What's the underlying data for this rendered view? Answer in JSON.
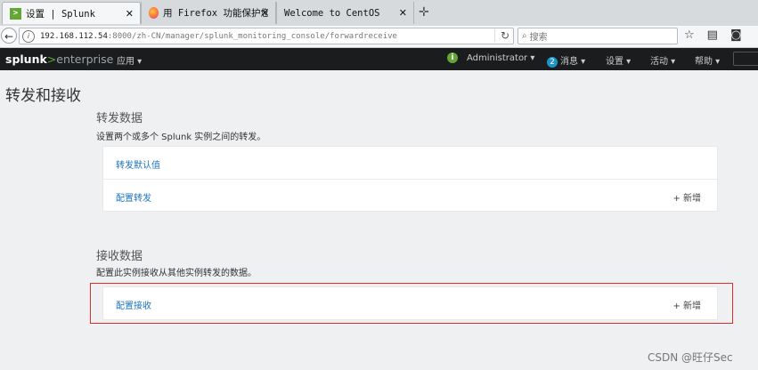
{
  "browser": {
    "tabs": [
      {
        "title": "设置 | Splunk",
        "active": true
      },
      {
        "title": "用 Firefox 功能保护您···",
        "active": false
      },
      {
        "title": "Welcome to CentOS",
        "active": false
      }
    ],
    "url_host": "192.168.112.54",
    "url_path": ":8000/zh-CN/manager/splunk_monitoring_console/forwardreceive",
    "search_placeholder": "搜索"
  },
  "splunk_header": {
    "logo_main": "splunk",
    "logo_gt": ">",
    "logo_suffix": "enterprise",
    "app_menu": "应用 ▾",
    "user_menu": "Administrator ▾",
    "messages_count": "2",
    "messages_menu": "消息 ▾",
    "settings_menu": "设置 ▾",
    "activity_menu": "活动 ▾",
    "help_menu": "帮助 ▾"
  },
  "page": {
    "title": "转发和接收",
    "forward": {
      "title": "转发数据",
      "desc": "设置两个或多个 Splunk 实例之间的转发。",
      "rows": [
        {
          "label": "转发默认值"
        },
        {
          "label": "配置转发",
          "action": "+ 新增"
        }
      ]
    },
    "receive": {
      "title": "接收数据",
      "desc": "配置此实例接收从其他实例转发的数据。",
      "rows": [
        {
          "label": "配置接收",
          "action": "+ 新增"
        }
      ]
    }
  },
  "watermark": "CSDN @旺仔Sec",
  "colors": {
    "accent_green": "#65a637",
    "link_blue": "#1e73be",
    "highlight_red": "#e02b2b",
    "header_bg": "#1a1c1e"
  }
}
